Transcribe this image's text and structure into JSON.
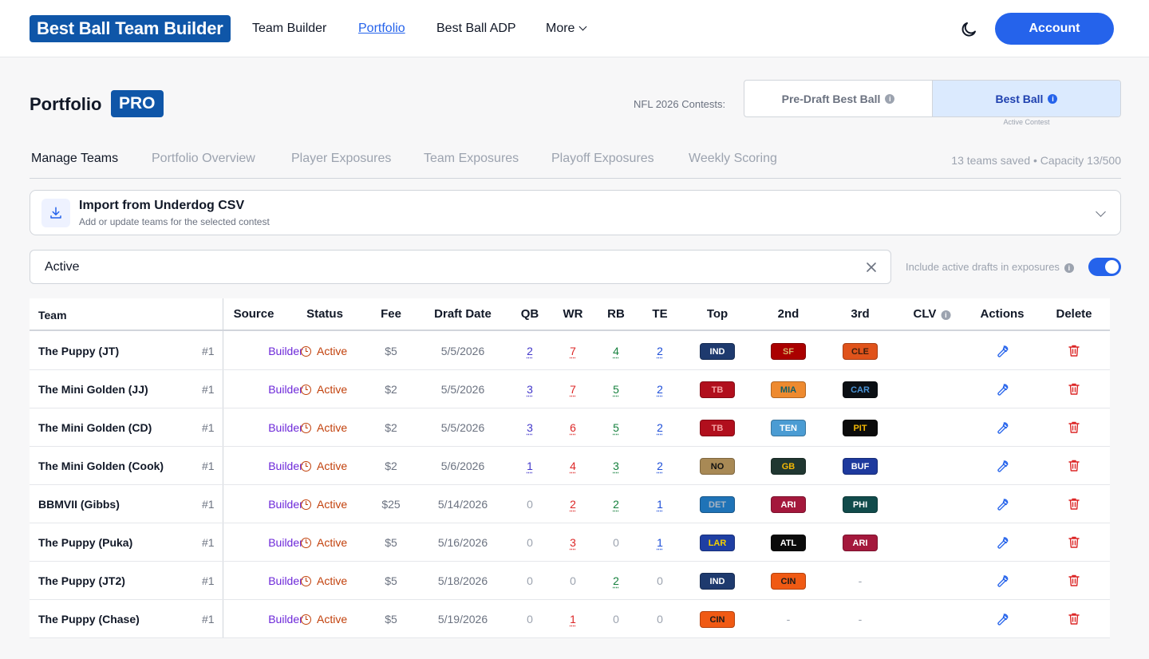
{
  "brand": "Best Ball Team Builder",
  "nav": {
    "items": [
      "Team Builder",
      "Portfolio",
      "Best Ball ADP",
      "More"
    ],
    "active": "Portfolio",
    "account_label": "Account"
  },
  "page": {
    "title": "Portfolio",
    "badge": "PRO",
    "contests_label": "NFL 2026 Contests:",
    "contests": [
      "Pre-Draft Best Ball",
      "Best Ball"
    ],
    "active_contest_note": "Active Contest"
  },
  "tabs": [
    "Manage Teams",
    "Portfolio Overview",
    "Player Exposures",
    "Team Exposures",
    "Playoff Exposures",
    "Weekly Scoring"
  ],
  "capacity_text": "13 teams saved • Capacity 13/500",
  "import": {
    "title": "Import from Underdog CSV",
    "subtitle": "Add or update teams for the selected contest"
  },
  "filter": {
    "value": "Active",
    "toggle_label": "Include active drafts in exposures",
    "toggle_on": true
  },
  "table": {
    "columns": [
      "Team",
      "Source",
      "Status",
      "Fee",
      "Draft Date",
      "QB",
      "WR",
      "RB",
      "TE",
      "Top",
      "2nd",
      "3rd",
      "CLV",
      "Actions",
      "Delete"
    ],
    "rows": [
      {
        "name": "The Puppy (JT)",
        "rank": "#1",
        "source": "Builder",
        "status": "Active",
        "fee": "$5",
        "date": "5/5/2026",
        "qb": "2",
        "wr": "7",
        "rb": "4",
        "te": "2",
        "top": [
          "IND",
          "SF",
          "CLE"
        ]
      },
      {
        "name": "The Mini Golden (JJ)",
        "rank": "#1",
        "source": "Builder",
        "status": "Active",
        "fee": "$2",
        "date": "5/5/2026",
        "qb": "3",
        "wr": "7",
        "rb": "5",
        "te": "2",
        "top": [
          "TB",
          "MIA",
          "CAR"
        ]
      },
      {
        "name": "The Mini Golden (CD)",
        "rank": "#1",
        "source": "Builder",
        "status": "Active",
        "fee": "$2",
        "date": "5/5/2026",
        "qb": "3",
        "wr": "6",
        "rb": "5",
        "te": "2",
        "top": [
          "TB",
          "TEN",
          "PIT"
        ]
      },
      {
        "name": "The Mini Golden (Cook)",
        "rank": "#1",
        "source": "Builder",
        "status": "Active",
        "fee": "$2",
        "date": "5/6/2026",
        "qb": "1",
        "wr": "4",
        "rb": "3",
        "te": "2",
        "top": [
          "NO",
          "GB",
          "BUF"
        ]
      },
      {
        "name": "BBMVII (Gibbs)",
        "rank": "#1",
        "source": "Builder",
        "status": "Active",
        "fee": "$25",
        "date": "5/14/2026",
        "qb": "0",
        "wr": "2",
        "rb": "2",
        "te": "1",
        "top": [
          "DET",
          "ARI",
          "PHI"
        ]
      },
      {
        "name": "The Puppy (Puka)",
        "rank": "#1",
        "source": "Builder",
        "status": "Active",
        "fee": "$5",
        "date": "5/16/2026",
        "qb": "0",
        "wr": "3",
        "rb": "0",
        "te": "1",
        "top": [
          "LAR",
          "ATL",
          "ARI"
        ]
      },
      {
        "name": "The Puppy (JT2)",
        "rank": "#1",
        "source": "Builder",
        "status": "Active",
        "fee": "$5",
        "date": "5/18/2026",
        "qb": "0",
        "wr": "0",
        "rb": "2",
        "te": "0",
        "top": [
          "IND",
          "CIN",
          "-"
        ]
      },
      {
        "name": "The Puppy (Chase)",
        "rank": "#1",
        "source": "Builder",
        "status": "Active",
        "fee": "$5",
        "date": "5/19/2026",
        "qb": "0",
        "wr": "1",
        "rb": "0",
        "te": "0",
        "top": [
          "CIN",
          "-",
          "-"
        ]
      }
    ]
  },
  "team_colors": {
    "IND": {
      "bg": "#1e3a6e",
      "fg": "#ffffff"
    },
    "SF": {
      "bg": "#aa0000",
      "fg": "#d4b26a"
    },
    "CLE": {
      "bg": "#e0531b",
      "fg": "#3a1d0e"
    },
    "TB": {
      "bg": "#b10f1d",
      "fg": "#f3a3a3"
    },
    "MIA": {
      "bg": "#ee8a2f",
      "fg": "#0e5e68"
    },
    "CAR": {
      "bg": "#0b0f14",
      "fg": "#4a93d6"
    },
    "TEN": {
      "bg": "#4b9cd3",
      "fg": "#ffffff"
    },
    "PIT": {
      "bg": "#0b0b0b",
      "fg": "#f2b705"
    },
    "NO": {
      "bg": "#a88955",
      "fg": "#111111"
    },
    "GB": {
      "bg": "#203731",
      "fg": "#f2b705"
    },
    "BUF": {
      "bg": "#1e3a9e",
      "fg": "#ffffff"
    },
    "DET": {
      "bg": "#1f73b7",
      "fg": "#a9b4c2"
    },
    "ARI": {
      "bg": "#a4183c",
      "fg": "#ffffff"
    },
    "PHI": {
      "bg": "#114b4b",
      "fg": "#ffffff"
    },
    "LAR": {
      "bg": "#1f3fa3",
      "fg": "#f5d000"
    },
    "ATL": {
      "bg": "#0b0b0b",
      "fg": "#ffffff"
    },
    "CIN": {
      "bg": "#f05a14",
      "fg": "#1a1a1a"
    }
  },
  "icons": {
    "theme": "moon-icon",
    "import": "download-icon",
    "clear": "close-icon",
    "info": "info-icon",
    "action": "wrench-icon",
    "delete": "trash-icon",
    "status": "clock-icon"
  }
}
